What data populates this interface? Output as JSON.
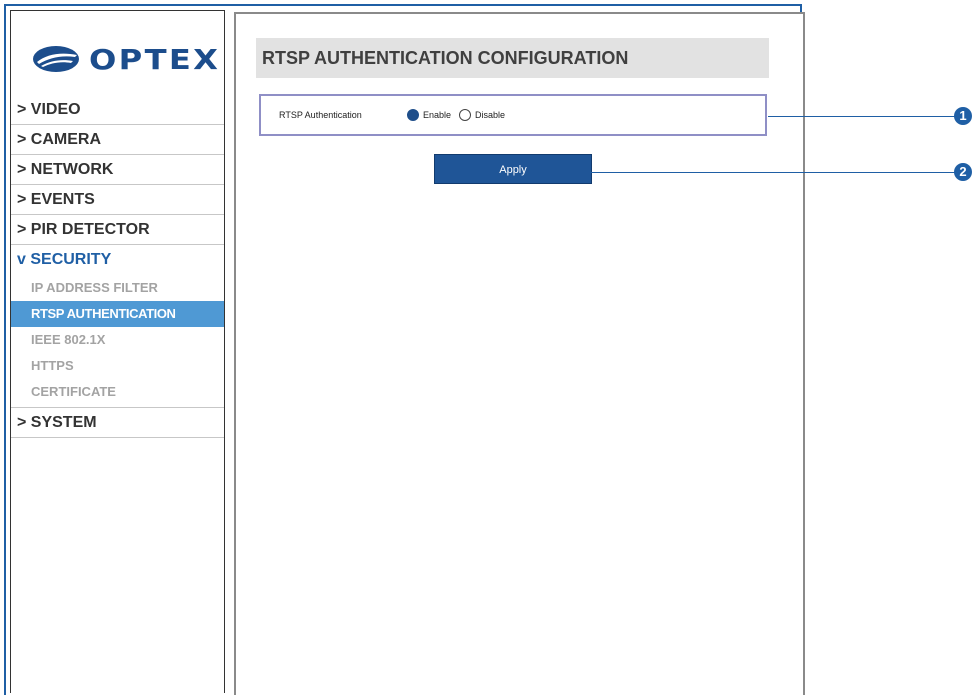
{
  "brand": {
    "logo_text": "OPTEX",
    "color": "#1c4d8c"
  },
  "sidebar": {
    "items": [
      {
        "label": "> VIDEO"
      },
      {
        "label": "> CAMERA"
      },
      {
        "label": "> NETWORK"
      },
      {
        "label": "> EVENTS"
      },
      {
        "label": "> PIR DETECTOR"
      },
      {
        "label": "v SECURITY"
      }
    ],
    "security_subitems": [
      {
        "label": "IP ADDRESS FILTER"
      },
      {
        "label": "RTSP AUTHENTICATION"
      },
      {
        "label": "IEEE 802.1X"
      },
      {
        "label": "HTTPS"
      },
      {
        "label": "CERTIFICATE"
      }
    ],
    "system_label": "> SYSTEM",
    "selected_subitem": "RTSP AUTHENTICATION"
  },
  "main": {
    "title": "RTSP AUTHENTICATION CONFIGURATION",
    "setting": {
      "label": "RTSP Authentication",
      "options": [
        {
          "label": "Enable",
          "checked": true
        },
        {
          "label": "Disable",
          "checked": false
        }
      ]
    },
    "apply_label": "Apply"
  },
  "callouts": [
    "1",
    "2"
  ],
  "colors": {
    "accent": "#1f5fa5",
    "selected_bg": "#4f99d4",
    "button_bg": "#1f5597"
  }
}
